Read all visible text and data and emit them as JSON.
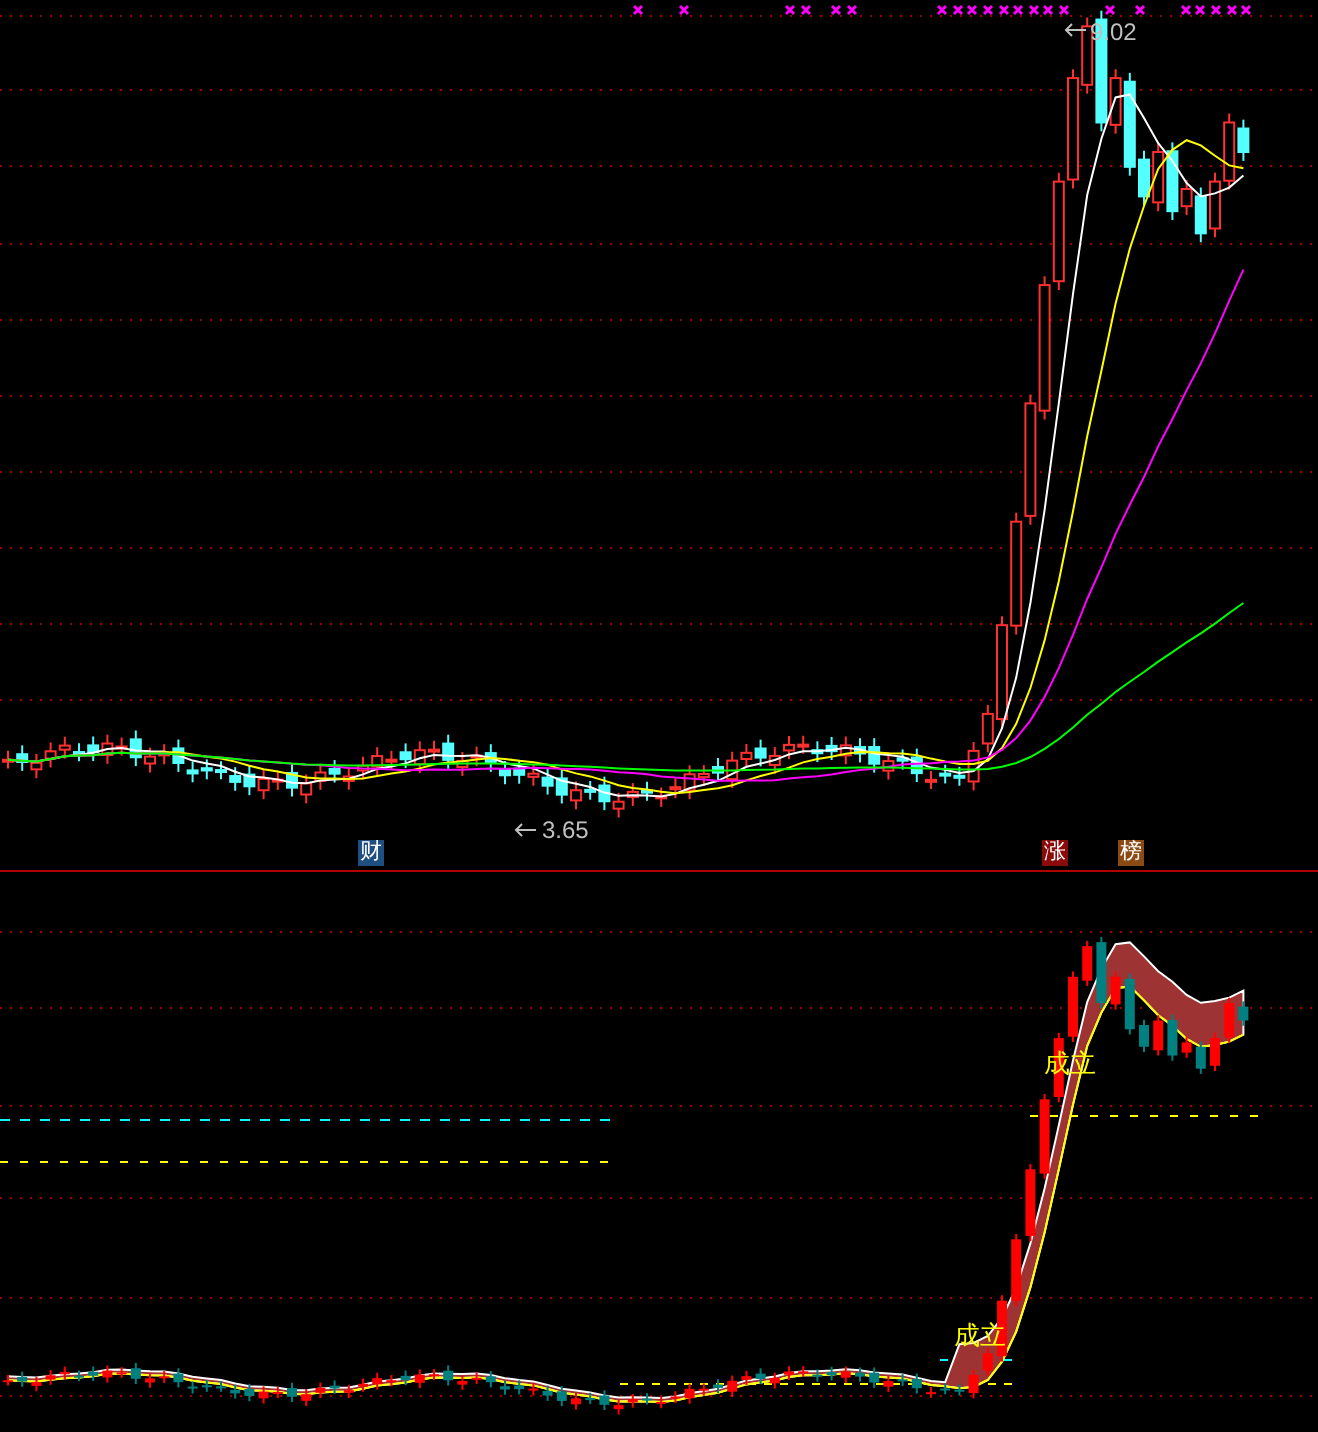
{
  "top_panel": {
    "high_label": "9.02",
    "low_label": "3.65",
    "tags": [
      {
        "text": "财",
        "color": "#1f4f80"
      },
      {
        "text": "涨",
        "color": "#8b0a0a"
      },
      {
        "text": "榜",
        "color": "#8b4a14"
      }
    ]
  },
  "bottom_panel": {
    "signals": [
      {
        "text": "成立"
      },
      {
        "text": "成立"
      }
    ]
  }
}
